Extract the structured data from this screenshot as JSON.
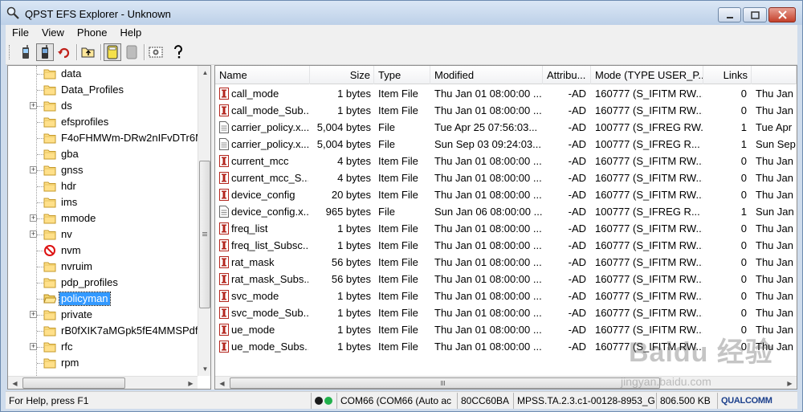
{
  "window": {
    "title": "QPST EFS Explorer - Unknown"
  },
  "menu": {
    "items": [
      "File",
      "View",
      "Phone",
      "Help"
    ]
  },
  "toolbar": {
    "buttons": [
      "phone-icon",
      "phone-selected-icon",
      "refresh-icon",
      "up-folder-icon",
      "drive-icon",
      "drive-gray-icon",
      "settings-icon",
      "help-icon"
    ]
  },
  "tree": {
    "items": [
      {
        "label": "data",
        "expandable": false
      },
      {
        "label": "Data_Profiles",
        "expandable": false
      },
      {
        "label": "ds",
        "expandable": true
      },
      {
        "label": "efsprofiles",
        "expandable": false
      },
      {
        "label": "F4oFHMWm-DRw2nIFvDTr6M",
        "expandable": false
      },
      {
        "label": "gba",
        "expandable": false
      },
      {
        "label": "gnss",
        "expandable": true
      },
      {
        "label": "hdr",
        "expandable": false
      },
      {
        "label": "ims",
        "expandable": false
      },
      {
        "label": "mmode",
        "expandable": true
      },
      {
        "label": "nv",
        "expandable": true
      },
      {
        "label": "nvm",
        "expandable": false,
        "icon": "forbidden-icon"
      },
      {
        "label": "nvruim",
        "expandable": false
      },
      {
        "label": "pdp_profiles",
        "expandable": false
      },
      {
        "label": "policyman",
        "expandable": false,
        "selected": true,
        "open": true
      },
      {
        "label": "private",
        "expandable": true
      },
      {
        "label": "rB0fXIK7aMGpk5fE4MMSPdf",
        "expandable": false
      },
      {
        "label": "rfc",
        "expandable": true
      },
      {
        "label": "rpm",
        "expandable": false
      }
    ]
  },
  "list": {
    "columns": [
      "Name",
      "Size",
      "Type",
      "Modified",
      "Attribu...",
      "Mode (TYPE USER_P...",
      "Links",
      ""
    ],
    "rows": [
      {
        "name": "call_mode",
        "size": "1 bytes",
        "type": "Item File",
        "modified": "Thu Jan 01 08:00:00 ...",
        "attr": "-AD",
        "mode": "160777 (S_IFITM RW...",
        "links": "0",
        "extra": "Thu Jan",
        "icon": "item"
      },
      {
        "name": "call_mode_Sub...",
        "size": "1 bytes",
        "type": "Item File",
        "modified": "Thu Jan 01 08:00:00 ...",
        "attr": "-AD",
        "mode": "160777 (S_IFITM RW...",
        "links": "0",
        "extra": "Thu Jan",
        "icon": "item"
      },
      {
        "name": "carrier_policy.x...",
        "size": "5,004 bytes",
        "type": "File",
        "modified": "Tue Apr 25 07:56:03...",
        "attr": "-AD",
        "mode": "100777 (S_IFREG RW...",
        "links": "1",
        "extra": "Tue Apr",
        "icon": "file"
      },
      {
        "name": "carrier_policy.x...",
        "size": "5,004 bytes",
        "type": "File",
        "modified": "Sun Sep 03 09:24:03...",
        "attr": "-AD",
        "mode": "100777 (S_IFREG R...",
        "links": "1",
        "extra": "Sun Sep",
        "icon": "file"
      },
      {
        "name": "current_mcc",
        "size": "4 bytes",
        "type": "Item File",
        "modified": "Thu Jan 01 08:00:00 ...",
        "attr": "-AD",
        "mode": "160777 (S_IFITM RW...",
        "links": "0",
        "extra": "Thu Jan",
        "icon": "item"
      },
      {
        "name": "current_mcc_S...",
        "size": "4 bytes",
        "type": "Item File",
        "modified": "Thu Jan 01 08:00:00 ...",
        "attr": "-AD",
        "mode": "160777 (S_IFITM RW...",
        "links": "0",
        "extra": "Thu Jan",
        "icon": "item"
      },
      {
        "name": "device_config",
        "size": "20 bytes",
        "type": "Item File",
        "modified": "Thu Jan 01 08:00:00 ...",
        "attr": "-AD",
        "mode": "160777 (S_IFITM RW...",
        "links": "0",
        "extra": "Thu Jan",
        "icon": "item"
      },
      {
        "name": "device_config.x...",
        "size": "965 bytes",
        "type": "File",
        "modified": "Sun Jan 06 08:00:00 ...",
        "attr": "-AD",
        "mode": "100777 (S_IFREG R...",
        "links": "1",
        "extra": "Sun Jan",
        "icon": "file"
      },
      {
        "name": "freq_list",
        "size": "1 bytes",
        "type": "Item File",
        "modified": "Thu Jan 01 08:00:00 ...",
        "attr": "-AD",
        "mode": "160777 (S_IFITM RW...",
        "links": "0",
        "extra": "Thu Jan",
        "icon": "item"
      },
      {
        "name": "freq_list_Subsc...",
        "size": "1 bytes",
        "type": "Item File",
        "modified": "Thu Jan 01 08:00:00 ...",
        "attr": "-AD",
        "mode": "160777 (S_IFITM RW...",
        "links": "0",
        "extra": "Thu Jan",
        "icon": "item"
      },
      {
        "name": "rat_mask",
        "size": "56 bytes",
        "type": "Item File",
        "modified": "Thu Jan 01 08:00:00 ...",
        "attr": "-AD",
        "mode": "160777 (S_IFITM RW...",
        "links": "0",
        "extra": "Thu Jan",
        "icon": "item"
      },
      {
        "name": "rat_mask_Subs...",
        "size": "56 bytes",
        "type": "Item File",
        "modified": "Thu Jan 01 08:00:00 ...",
        "attr": "-AD",
        "mode": "160777 (S_IFITM RW...",
        "links": "0",
        "extra": "Thu Jan",
        "icon": "item"
      },
      {
        "name": "svc_mode",
        "size": "1 bytes",
        "type": "Item File",
        "modified": "Thu Jan 01 08:00:00 ...",
        "attr": "-AD",
        "mode": "160777 (S_IFITM RW...",
        "links": "0",
        "extra": "Thu Jan",
        "icon": "item"
      },
      {
        "name": "svc_mode_Sub...",
        "size": "1 bytes",
        "type": "Item File",
        "modified": "Thu Jan 01 08:00:00 ...",
        "attr": "-AD",
        "mode": "160777 (S_IFITM RW...",
        "links": "0",
        "extra": "Thu Jan",
        "icon": "item"
      },
      {
        "name": "ue_mode",
        "size": "1 bytes",
        "type": "Item File",
        "modified": "Thu Jan 01 08:00:00 ...",
        "attr": "-AD",
        "mode": "160777 (S_IFITM RW...",
        "links": "0",
        "extra": "Thu Jan",
        "icon": "item"
      },
      {
        "name": "ue_mode_Subs...",
        "size": "1 bytes",
        "type": "Item File",
        "modified": "Thu Jan 01 08:00:00 ...",
        "attr": "-AD",
        "mode": "160777 (S_IFITM RW...",
        "links": "0",
        "extra": "Thu Jan",
        "icon": "item"
      }
    ]
  },
  "status": {
    "help": "For Help, press F1",
    "port": "COM66 (COM66 (Auto ac",
    "esn": "80CC60BA",
    "build": "MPSS.TA.2.3.c1-00128-8953_G",
    "free": "806.500 KB",
    "brand": "QUALCOMM"
  },
  "watermark": {
    "text": "Baidu 经验",
    "url": "jingyan.baidu.com"
  },
  "colors": {
    "selection": "#3399ff",
    "item_icon": "#b3261e",
    "brand": "#1b3f8b"
  }
}
